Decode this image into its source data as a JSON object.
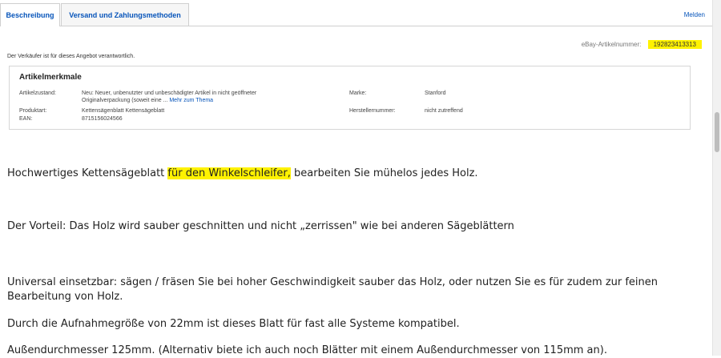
{
  "tabs": [
    {
      "label": "Beschreibung",
      "active": true
    },
    {
      "label": "Versand und Zahlungsmethoden",
      "active": false
    }
  ],
  "report_link": "Melden",
  "item_number": {
    "label": "eBay-Artikelnummer:",
    "value": "192823413313"
  },
  "seller_note": "Der Verkäufer ist für dieses Angebot verantwortlich.",
  "specifics": {
    "title": "Artikelmerkmale",
    "condition": {
      "label": "Artikelzustand:",
      "value_line1": "Neu: Neuer, unbenutzter und unbeschädigter Artikel in nicht geöffneter",
      "value_line2": "Originalverpackung (soweit eine ...",
      "more_link": "Mehr zum Thema"
    },
    "product_type": {
      "label": "Produktart:",
      "value": "Kettensägenblatt Kettensägeblatt"
    },
    "ean": {
      "label": "EAN:",
      "value": "8715156024566"
    },
    "brand": {
      "label": "Marke:",
      "value": "Stanford"
    },
    "mpn": {
      "label": "Herstellernummer:",
      "value": "nicht zutreffend"
    }
  },
  "description": {
    "line1_before": "Hochwertiges Kettensägeblatt ",
    "line1_highlight": "für den Winkelschleifer,",
    "line1_after": " bearbeiten Sie mühelos jedes Holz.",
    "line2": "Der Vorteil: Das Holz wird sauber geschnitten und nicht „zerrissen\" wie bei anderen Sägeblättern",
    "line3a": "Universal einsetzbar: sägen / fräsen Sie bei hoher Geschwindigkeit sauber das Holz, oder nutzen Sie es für zudem zur feinen",
    "line3b": "Bearbeitung von Holz.",
    "line4": "Durch die Aufnahmegröße von 22mm ist dieses Blatt für fast alle Systeme kompatibel.",
    "line5": "Außendurchmesser 125mm. (Alternativ biete ich auch noch Blätter mit einem Außendurchmesser von 115mm an)."
  },
  "colors": {
    "link": "#0654ba",
    "highlight": "#fff200"
  }
}
